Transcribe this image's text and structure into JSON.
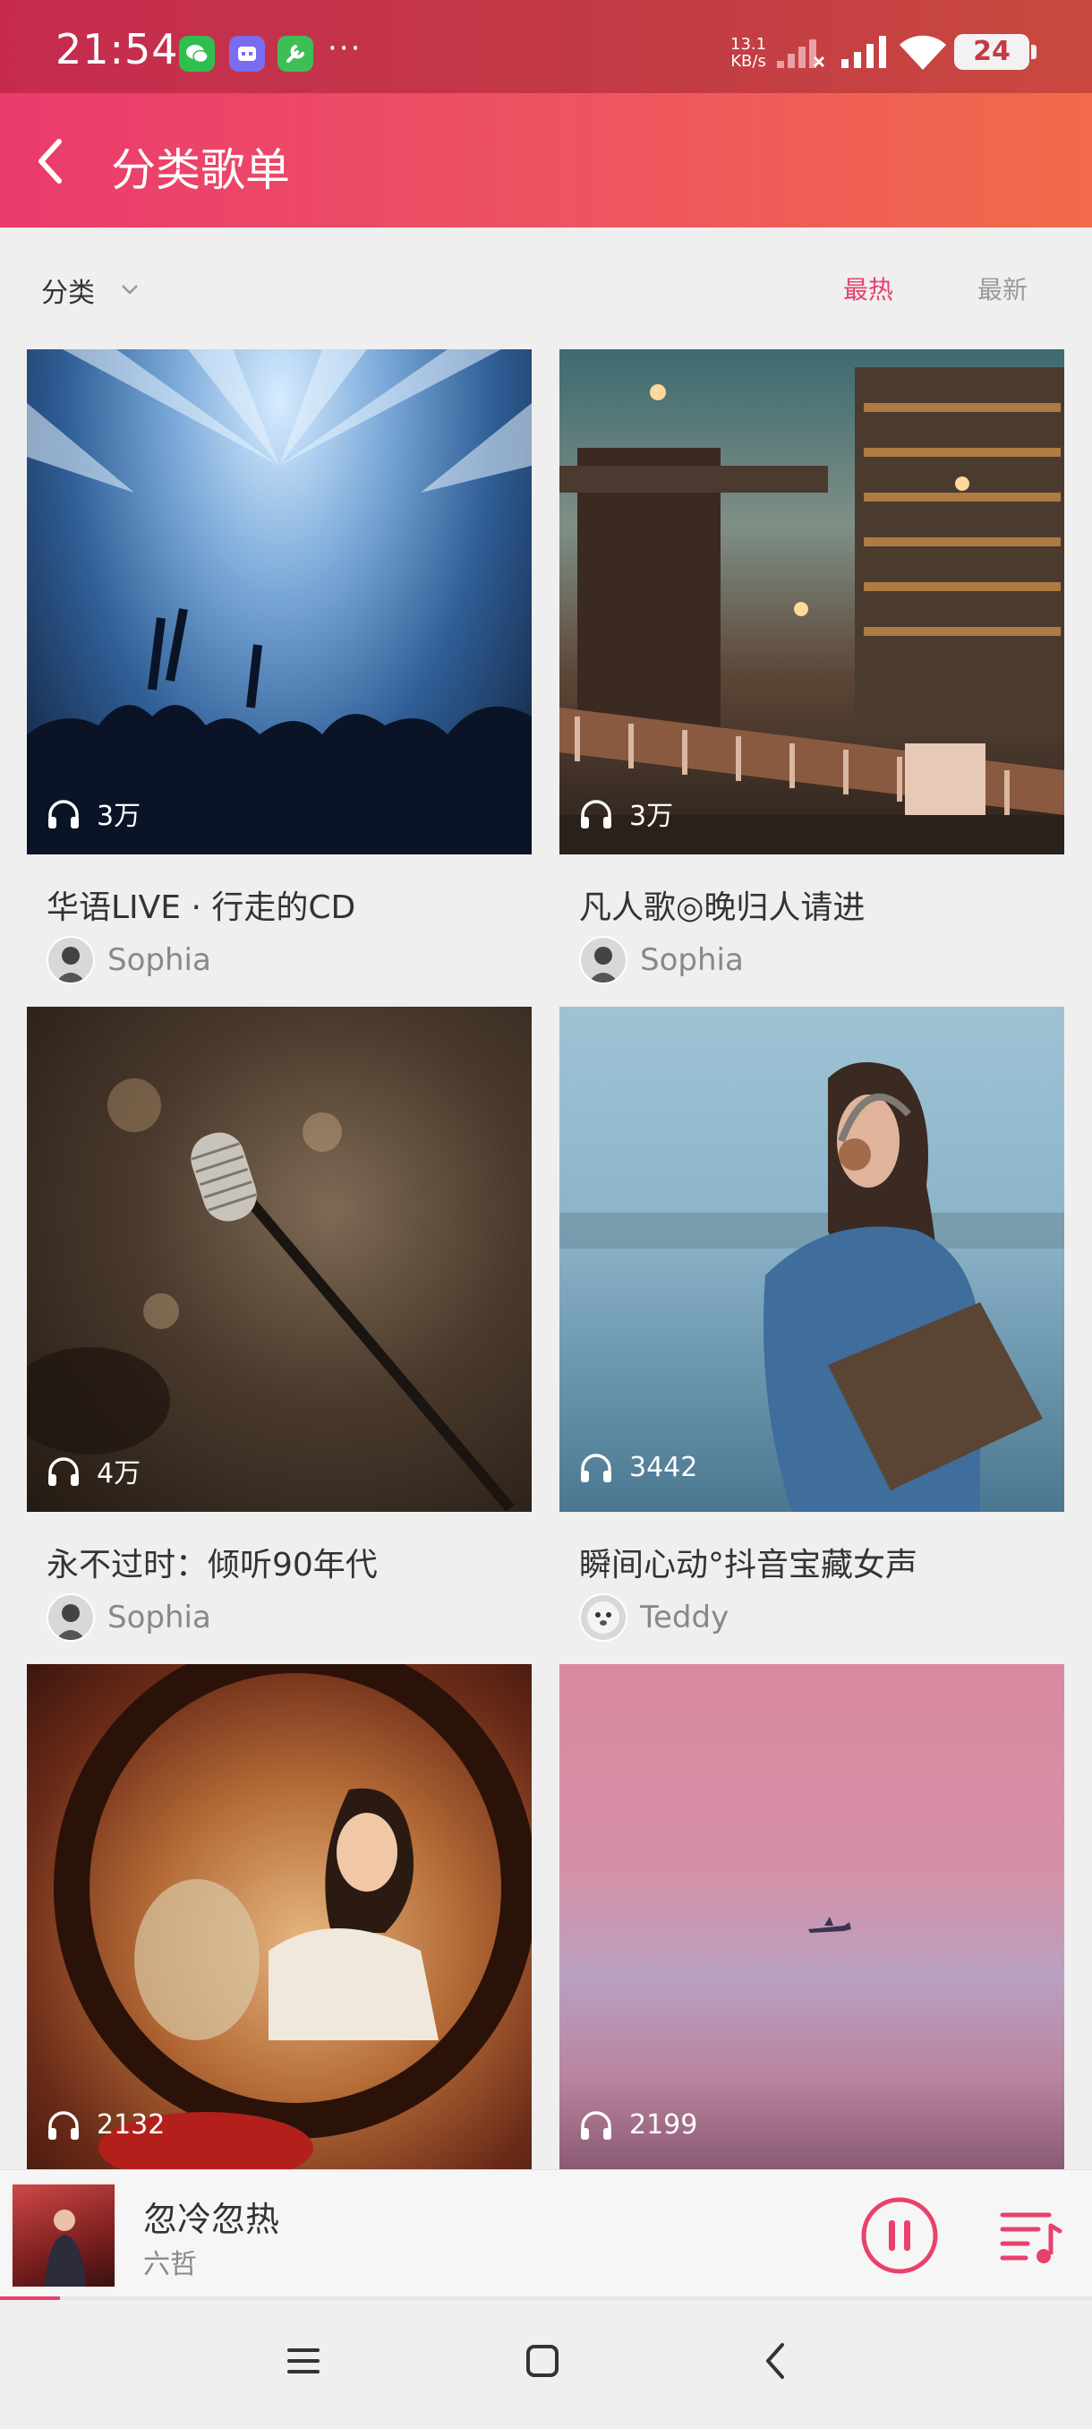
{
  "status_bar": {
    "time": "21:54",
    "more": "···",
    "net_speed_value": "13.1",
    "net_speed_unit": "KB/s",
    "battery": "24",
    "icons": [
      "wechat-icon",
      "game-icon",
      "tool-icon",
      "signal-icon",
      "signal-icon",
      "wifi-icon",
      "battery-icon"
    ]
  },
  "header": {
    "title": "分类歌单",
    "back_icon": "chevron-left-icon"
  },
  "filter": {
    "category_label": "分类",
    "sort_hot": "最热",
    "sort_new": "最新",
    "active_sort": "最热",
    "accent_color": "#e8416c"
  },
  "playlists": [
    {
      "title": "华语LIVE · 行走的CD",
      "plays": "3万",
      "author": "Sophia",
      "cover": "concert"
    },
    {
      "title": "凡人歌◎晚归人请进",
      "plays": "3万",
      "author": "Sophia",
      "cover": "city-night"
    },
    {
      "title": "永不过时：倾听90年代",
      "plays": "4万",
      "author": "Sophia",
      "cover": "microphone"
    },
    {
      "title": "瞬间心动°抖音宝藏女声",
      "plays": "3442",
      "author": "Teddy",
      "cover": "headphones-girl"
    },
    {
      "title": "",
      "plays": "2132",
      "author": "",
      "cover": "mirror-portrait"
    },
    {
      "title": "",
      "plays": "2199",
      "author": "",
      "cover": "pink-sky"
    }
  ],
  "player": {
    "song": "忽冷忽热",
    "artist": "六哲",
    "progress": 0.055,
    "state": "playing"
  }
}
